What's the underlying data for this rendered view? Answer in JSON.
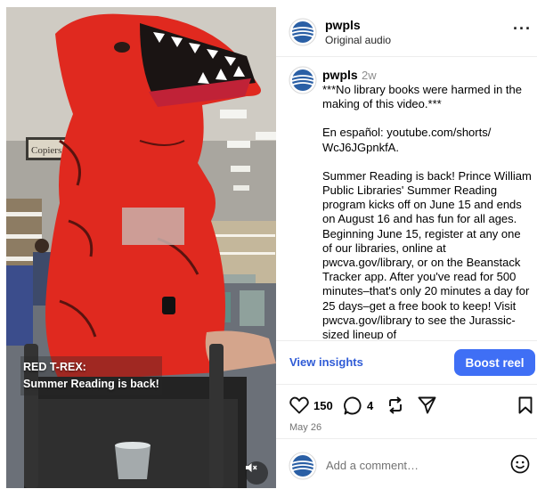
{
  "colors": {
    "accent": "#3f6ff5",
    "link": "#2f5bd6",
    "muted": "#737373",
    "suit_red": "#e0291f"
  },
  "media": {
    "caption_line1": "RED T-REX:",
    "caption_line2": "Summer Reading is back!",
    "mute_icon": "speaker-muted-icon"
  },
  "header": {
    "username": "pwpls",
    "audio": "Original audio",
    "more_icon": "more-icon",
    "more_glyph": "···"
  },
  "post": {
    "username": "pwpls",
    "time": "2w",
    "paragraphs": [
      "***No library books were harmed in the making of this video.***",
      "En español: youtube.com/shorts/ WcJ6JGpnkfA.",
      "Summer Reading is back! Prince William Public Libraries' Summer Reading program kicks off on June 15 and ends on August 16 and has fun for all ages. Beginning June 15, register at any one of our libraries, online at pwcva.gov/library, or on the Beanstack Tracker app. After you've read for 500 minutes–that's only 20 minutes a day for 25 days–get a free book to keep! Visit pwcva.gov/library to see the Jurassic-sized lineup of"
    ]
  },
  "insights": {
    "view_label": "View insights",
    "boost_label": "Boost reel"
  },
  "actions": {
    "likes": "150",
    "comments": "4",
    "date": "May 26",
    "icons": [
      "heart-icon",
      "comment-icon",
      "repost-icon",
      "send-icon",
      "bookmark-icon"
    ]
  },
  "comment_box": {
    "placeholder": "Add a comment…",
    "value": "",
    "emoji_icon": "emoji-icon"
  }
}
